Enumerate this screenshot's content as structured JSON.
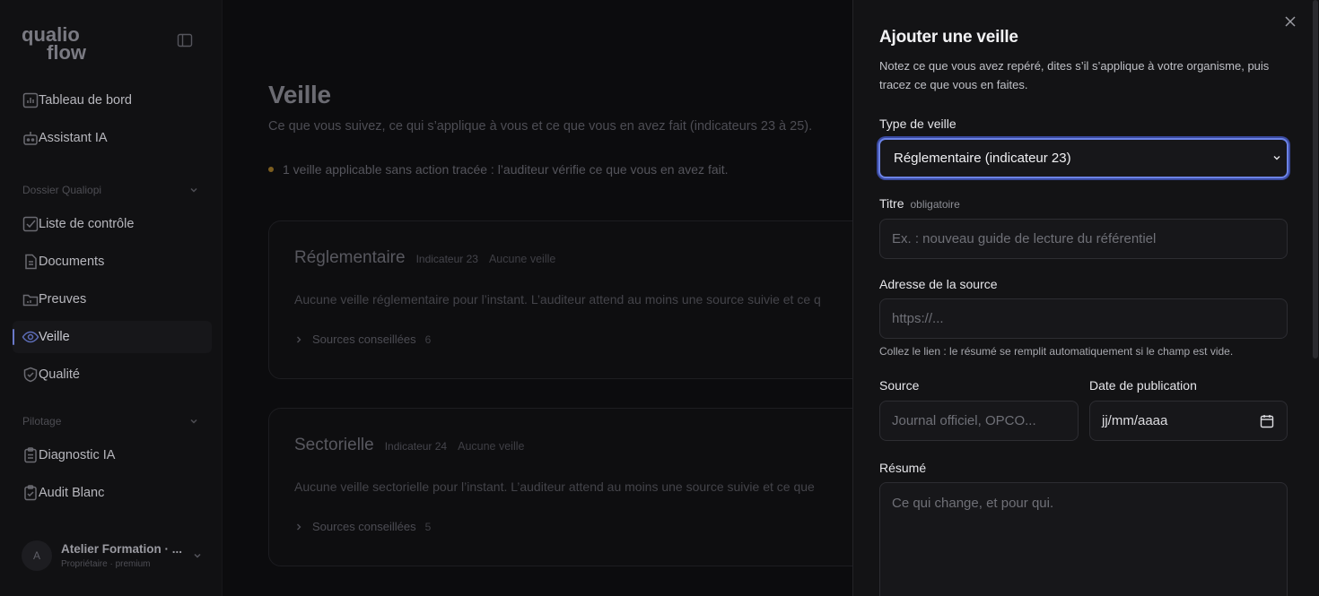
{
  "sidebar": {
    "logo_line1": "qualio",
    "logo_line2": "flow",
    "nav_top": [
      {
        "label": "Tableau de bord",
        "icon": "bar-chart-icon"
      },
      {
        "label": "Assistant IA",
        "icon": "robot-icon"
      }
    ],
    "section_dossier": "Dossier Qualiopi",
    "nav_dossier": [
      {
        "label": "Liste de contrôle",
        "icon": "checkbox-icon"
      },
      {
        "label": "Documents",
        "icon": "document-icon"
      },
      {
        "label": "Preuves",
        "icon": "folder-icon"
      },
      {
        "label": "Veille",
        "icon": "eye-icon"
      },
      {
        "label": "Qualité",
        "icon": "shield-icon"
      }
    ],
    "section_pilotage": "Pilotage",
    "nav_pilotage": [
      {
        "label": "Diagnostic IA",
        "icon": "clipboard-icon"
      },
      {
        "label": "Audit Blanc",
        "icon": "clipboard-check-icon"
      }
    ],
    "user": {
      "initial": "A",
      "name": "Atelier Formation · ...",
      "role": "Propriétaire · premium"
    }
  },
  "main": {
    "title": "Veille",
    "subtitle": "Ce que vous suivez, ce qui s’applique à vous et ce que vous en avez fait (indicateurs 23 à 25).",
    "alert": "1 veille applicable sans action tracée : l’auditeur vérifie ce que vous en avez fait.",
    "cards": [
      {
        "title": "Réglementaire",
        "indicator": "Indicateur 23",
        "status": "Aucune veille",
        "text": "Aucune veille réglementaire pour l’instant. L’auditeur attend au moins une source suivie et ce q",
        "sources_label": "Sources conseillées",
        "sources_count": "6"
      },
      {
        "title": "Sectorielle",
        "indicator": "Indicateur 24",
        "status": "Aucune veille",
        "text": "Aucune veille sectorielle pour l’instant. L’auditeur attend au moins une source suivie et ce que",
        "sources_label": "Sources conseillées",
        "sources_count": "5"
      }
    ]
  },
  "drawer": {
    "title": "Ajouter une veille",
    "description": "Notez ce que vous avez repéré, dites s’il s’applique à votre organisme, puis tracez ce que vous en faites.",
    "type_label": "Type de veille",
    "type_value": "Réglementaire (indicateur 23)",
    "title_label": "Titre",
    "title_required": "obligatoire",
    "title_placeholder": "Ex. : nouveau guide de lecture du référentiel",
    "source_url_label": "Adresse de la source",
    "source_url_placeholder": "https://...",
    "source_url_hint": "Collez le lien : le résumé se remplit automatiquement si le champ est vide.",
    "source_label": "Source",
    "source_placeholder": "Journal officiel, OPCO...",
    "date_label": "Date de publication",
    "date_placeholder": "jj/mm/aaaa",
    "summary_label": "Résumé",
    "summary_placeholder": "Ce qui change, et pour qui."
  },
  "colors": {
    "accent": "#6c83e6",
    "alert_dot": "#7c5d1f",
    "active_indicator": "#6a79c9"
  }
}
